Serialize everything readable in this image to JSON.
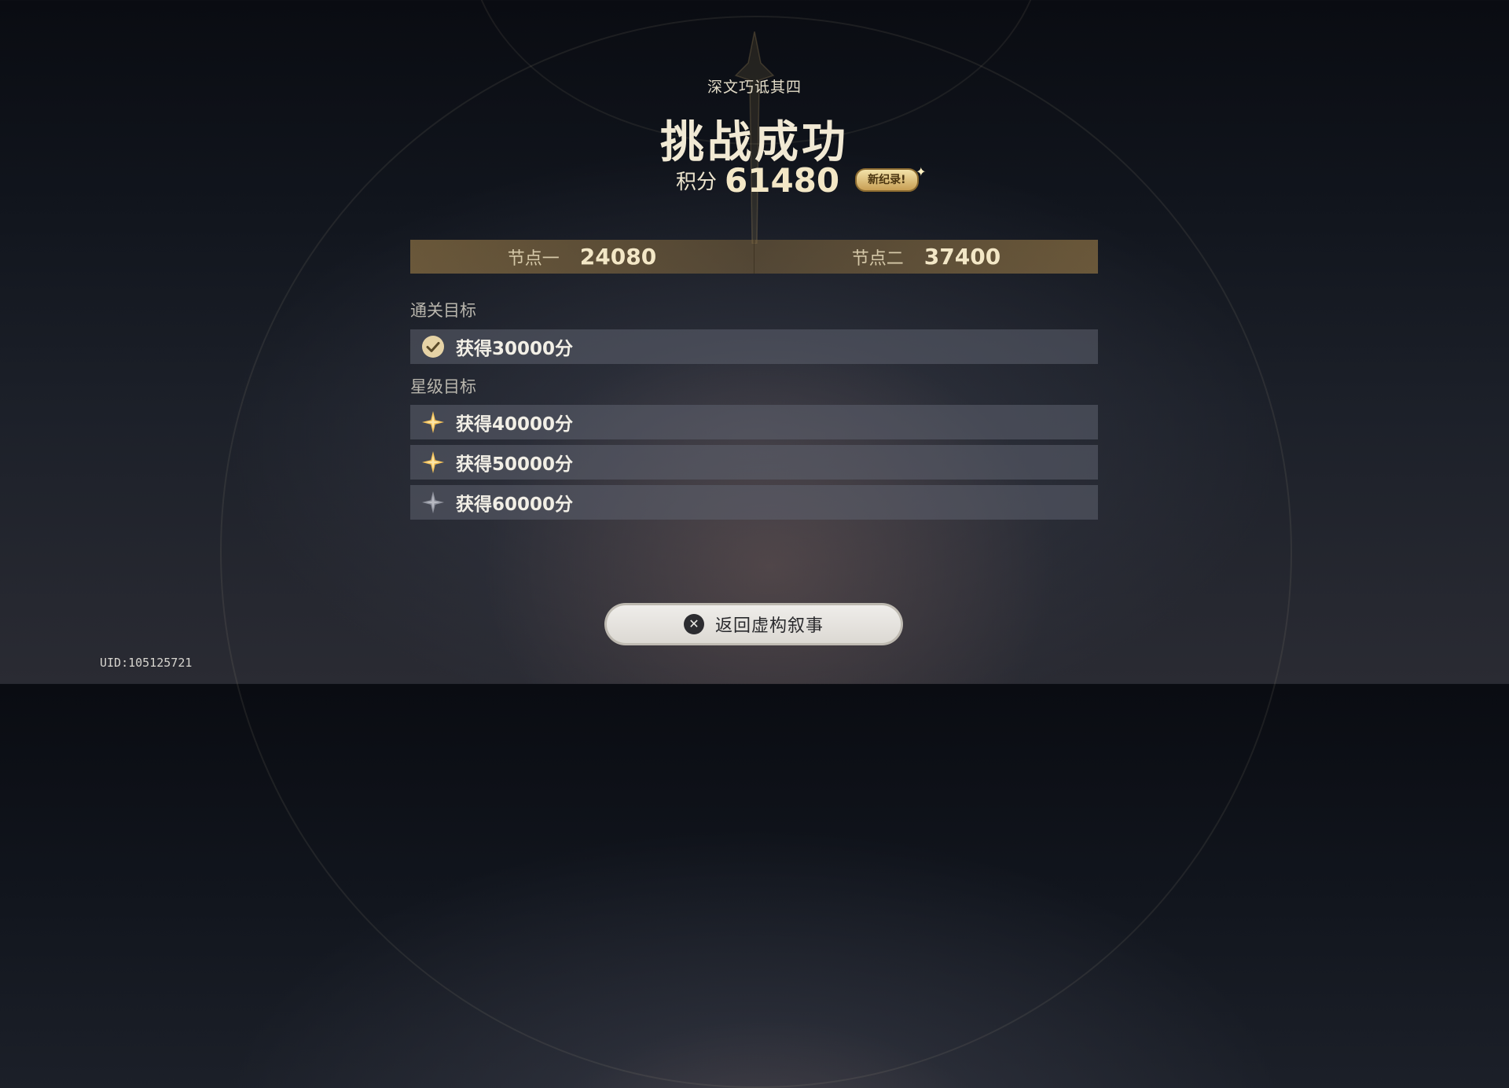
{
  "header": {
    "subtitle": "深文巧诋其四",
    "title": "挑战成功",
    "score_label": "积分",
    "score_value": "61480",
    "record_badge": "新纪录!"
  },
  "nodes": [
    {
      "label": "节点一",
      "value": "24080"
    },
    {
      "label": "节点二",
      "value": "37400"
    }
  ],
  "clear_goal": {
    "title": "通关目标",
    "items": [
      {
        "text": "获得30000分",
        "icon": "check-icon",
        "achieved": true
      }
    ]
  },
  "star_goal": {
    "title": "星级目标",
    "items": [
      {
        "text": "获得40000分",
        "icon": "star-icon",
        "achieved": true
      },
      {
        "text": "获得50000分",
        "icon": "star-icon",
        "achieved": true
      },
      {
        "text": "获得60000分",
        "icon": "star-icon",
        "achieved": false
      }
    ]
  },
  "footer": {
    "return_label": "返回虚构叙事",
    "return_icon": "close-icon",
    "uid": "UID:105125721"
  },
  "colors": {
    "gold": "#f3e7c6",
    "star_achieved": "#f4c25a",
    "star_unachieved": "#8f929d"
  }
}
